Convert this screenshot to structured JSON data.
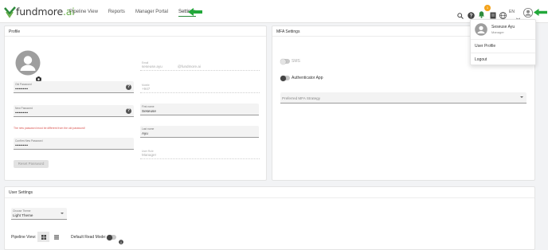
{
  "brand": {
    "name": "fundmore",
    "suffix": ".ai",
    "accent": "#6ab04c"
  },
  "nav": {
    "items": [
      {
        "label": "Pipeline View"
      },
      {
        "label": "Reports"
      },
      {
        "label": "Manager Portal"
      },
      {
        "label": "Settings",
        "active": true
      }
    ]
  },
  "topbar": {
    "notification_count": "1",
    "language": "EN",
    "icons": [
      "search-icon",
      "help-icon",
      "bell-icon",
      "document-icon",
      "globe-icon",
      "user-avatar-icon"
    ]
  },
  "user_menu": {
    "name": "Seseuse Ayu",
    "role": "Manager",
    "items": [
      "User Profile",
      "Logout"
    ]
  },
  "profile": {
    "title": "Profile",
    "old_password": {
      "label": "Old Password",
      "value": "••••••••••"
    },
    "new_password": {
      "label": "New Password",
      "value": "••••••••••"
    },
    "password_error": "The new password must be different from the old password!",
    "confirm_password": {
      "label": "Confirm New Password",
      "value": "••••••••••"
    },
    "reset_button": "Reset Password",
    "email": {
      "label": "Email",
      "value": "seseuse.ayu",
      "domain": "@fundmore.ai"
    },
    "mobile": {
      "label": "Mobile",
      "value": "+947"
    },
    "first_name": {
      "label": "First name",
      "value": "Seseuse"
    },
    "last_name": {
      "label": "Last name",
      "value": "Ayu"
    },
    "user_role": {
      "label": "User Role",
      "value": "Manager"
    }
  },
  "mfa": {
    "title": "MFA Settings",
    "sms_label": "SMS",
    "authenticator_label": "Authenticator App",
    "strategy_placeholder": "Preferred MFA Strategy"
  },
  "user_settings": {
    "title": "User Settings",
    "theme": {
      "label": "Choose Theme",
      "value": "Light Theme"
    },
    "pipeline_view_label": "Pipeline View:",
    "default_read_mode_label": "Default Read Mode:"
  }
}
